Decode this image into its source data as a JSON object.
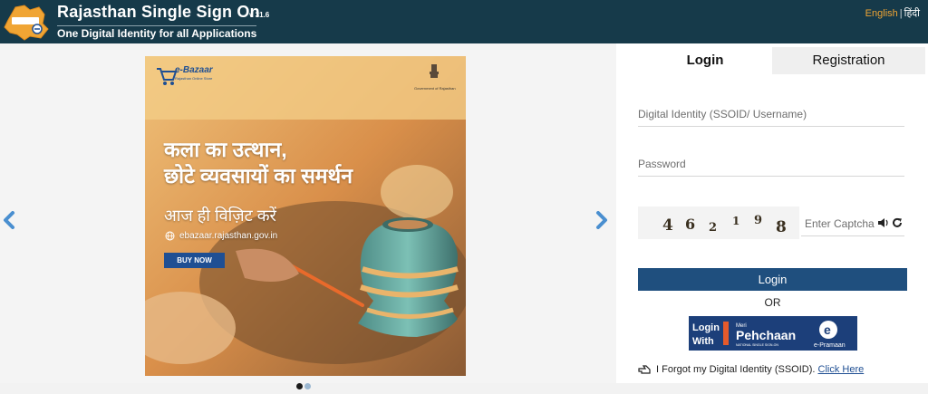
{
  "header": {
    "title": "Rajasthan Single Sign On",
    "version": "v 31.6",
    "subtitle": "One Digital Identity for all Applications",
    "lang_english": "English",
    "lang_separator": "|",
    "lang_hindi": "हिंदी"
  },
  "banner": {
    "brand": "e-Bazaar",
    "brand_sub": "Rajasthan Online Store",
    "gov": "Government of Rajasthan",
    "line1": "कला का उत्थान,",
    "line2": "छोटे व्यवसायों का समर्थन",
    "line3": "आज ही विज़िट करें",
    "url": "ebazaar.rajasthan.gov.in",
    "buy_label": "BUY NOW"
  },
  "login": {
    "tab_login": "Login",
    "tab_registration": "Registration",
    "id_placeholder": "Digital Identity (SSOID/ Username)",
    "password_placeholder": "Password",
    "captcha_digits": [
      "4",
      "6",
      "2",
      "1",
      "9",
      "8"
    ],
    "captcha_placeholder": "Enter Captcha",
    "login_button": "Login",
    "or_text": "OR",
    "pehchaan_login": "Login",
    "pehchaan_with": "With",
    "pehchaan_meri": "Meri",
    "pehchaan_name": "Pehchaan",
    "pehchaan_sub": "NATIONAL SINGLE SIGN-ON",
    "epramaan": "e-Pramaan",
    "forgot_text": "I Forgot my Digital Identity (SSOID).",
    "forgot_link": "Click Here"
  },
  "colors": {
    "header_bg": "#163a4a",
    "accent": "#f0a534",
    "button_blue": "#1f4f7e"
  }
}
